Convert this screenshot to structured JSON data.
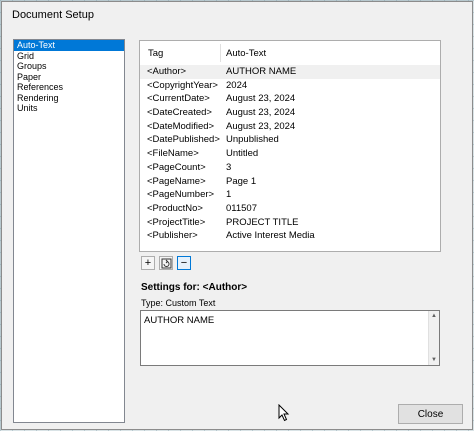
{
  "window": {
    "title": "Document Setup"
  },
  "sidebar": {
    "items": [
      {
        "label": "Auto-Text",
        "selected": true
      },
      {
        "label": "Grid"
      },
      {
        "label": "Groups"
      },
      {
        "label": "Paper"
      },
      {
        "label": "References"
      },
      {
        "label": "Rendering"
      },
      {
        "label": "Units"
      }
    ]
  },
  "table": {
    "headers": {
      "tag": "Tag",
      "value": "Auto-Text"
    },
    "rows": [
      {
        "tag": "<Author>",
        "value": "AUTHOR NAME",
        "selected": true
      },
      {
        "tag": "<CopyrightYear>",
        "value": "2024"
      },
      {
        "tag": "<CurrentDate>",
        "value": "August 23, 2024"
      },
      {
        "tag": "<DateCreated>",
        "value": "August 23, 2024"
      },
      {
        "tag": "<DateModified>",
        "value": "August 23, 2024"
      },
      {
        "tag": "<DatePublished>",
        "value": "Unpublished"
      },
      {
        "tag": "<FileName>",
        "value": "Untitled"
      },
      {
        "tag": "<PageCount>",
        "value": "3"
      },
      {
        "tag": "<PageName>",
        "value": "Page 1"
      },
      {
        "tag": "<PageNumber>",
        "value": "1"
      },
      {
        "tag": "<ProductNo>",
        "value": "011507"
      },
      {
        "tag": "<ProjectTitle>",
        "value": "PROJECT TITLE"
      },
      {
        "tag": "<Publisher>",
        "value": "Active Interest Media"
      }
    ]
  },
  "toolbar": {
    "add_icon": "plus-icon",
    "add_glyph": "+",
    "refresh_icon": "refresh-icon",
    "remove_icon": "minus-icon",
    "remove_glyph": "−"
  },
  "settings": {
    "title": "Settings for: <Author>",
    "type_label": "Type: Custom Text",
    "text_value": "AUTHOR NAME"
  },
  "footer": {
    "close_label": "Close"
  },
  "colors": {
    "selection": "#0078d7",
    "dialog_bg": "#f0f0f0"
  }
}
